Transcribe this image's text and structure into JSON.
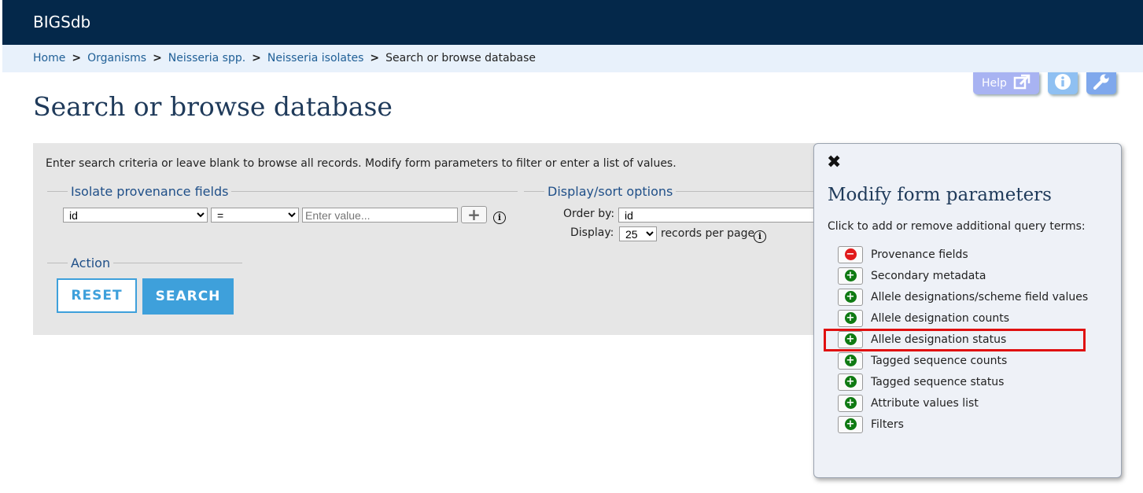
{
  "brand": "BIGSdb",
  "breadcrumb": {
    "items": [
      "Home",
      "Organisms",
      "Neisseria spp.",
      "Neisseria isolates"
    ],
    "separator": ">",
    "current": "Search or browse database"
  },
  "tool_buttons": {
    "help_label": "Help",
    "icons": [
      "external-link-icon",
      "info-icon",
      "wrench-icon"
    ]
  },
  "page_title": "Search or browse database",
  "search_panel": {
    "intro": "Enter search criteria or leave blank to browse all records. Modify form parameters to filter or enter a list of values.",
    "provenance": {
      "legend": "Isolate provenance fields",
      "field_value": "id",
      "operator_value": "=",
      "value_placeholder": "Enter value..."
    },
    "display": {
      "legend": "Display/sort options",
      "order_label": "Order by:",
      "order_value": "id",
      "display_label": "Display:",
      "display_value": "25",
      "records_suffix": "records per page"
    },
    "action": {
      "legend": "Action",
      "reset_label": "RESET",
      "search_label": "SEARCH"
    }
  },
  "modify_panel": {
    "close_symbol": "✖",
    "title": "Modify form parameters",
    "description": "Click to add or remove additional query terms:",
    "terms": [
      {
        "label": "Provenance fields",
        "state": "remove"
      },
      {
        "label": "Secondary metadata",
        "state": "add"
      },
      {
        "label": "Allele designations/scheme field values",
        "state": "add"
      },
      {
        "label": "Allele designation counts",
        "state": "add"
      },
      {
        "label": "Allele designation status",
        "state": "add",
        "highlighted": true
      },
      {
        "label": "Tagged sequence counts",
        "state": "add"
      },
      {
        "label": "Tagged sequence status",
        "state": "add"
      },
      {
        "label": "Attribute values list",
        "state": "add"
      },
      {
        "label": "Filters",
        "state": "add"
      }
    ]
  },
  "colors": {
    "topbar": "#04284a",
    "breadcrumb_bg": "#e8f1fb",
    "link": "#1f5f96",
    "button_blue": "#3ea0db",
    "add_green": "#0f7a12",
    "remove_red": "#e11a1a",
    "highlight_red": "#e01010"
  }
}
